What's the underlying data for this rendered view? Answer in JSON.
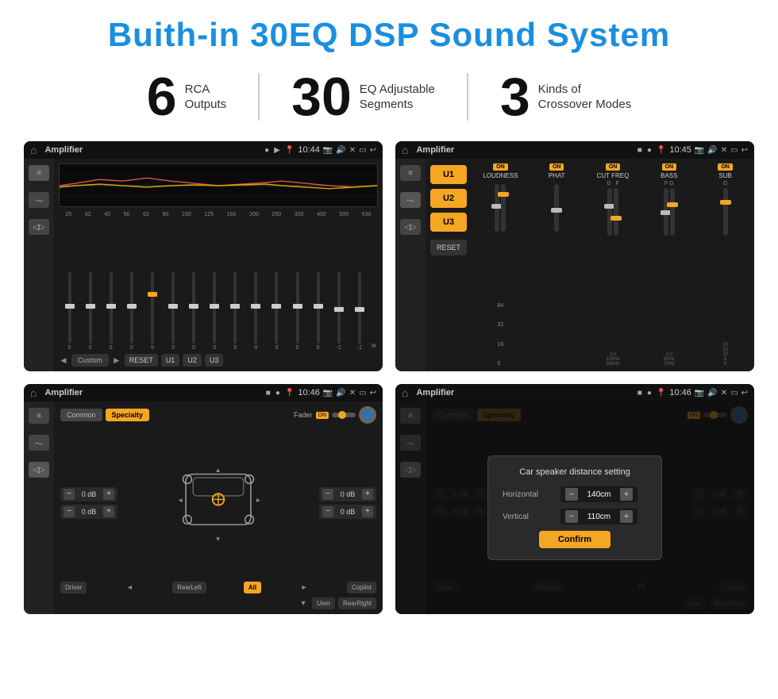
{
  "title": "Buith-in 30EQ DSP Sound System",
  "stats": [
    {
      "number": "6",
      "label": "RCA\nOutputs"
    },
    {
      "number": "30",
      "label": "EQ Adjustable\nSegments"
    },
    {
      "number": "3",
      "label": "Kinds of\nCrossover Modes"
    }
  ],
  "screens": [
    {
      "id": "screen1",
      "app_name": "Amplifier",
      "time": "10:44",
      "description": "EQ Sliders Screen"
    },
    {
      "id": "screen2",
      "app_name": "Amplifier",
      "time": "10:45",
      "description": "U1/U2/U3 Crossover Screen"
    },
    {
      "id": "screen3",
      "app_name": "Amplifier",
      "time": "10:46",
      "description": "Speaker Positioning Screen"
    },
    {
      "id": "screen4",
      "app_name": "Amplifier",
      "time": "10:46",
      "description": "Car Speaker Distance Dialog"
    }
  ],
  "eq_screen": {
    "frequencies": [
      "25",
      "32",
      "40",
      "50",
      "63",
      "80",
      "100",
      "125",
      "160",
      "200",
      "250",
      "320",
      "400",
      "500",
      "630"
    ],
    "values": [
      "0",
      "0",
      "0",
      "0",
      "5",
      "0",
      "0",
      "0",
      "0",
      "0",
      "0",
      "0",
      "0",
      "-1",
      "0",
      "-1"
    ],
    "preset": "Custom",
    "buttons": [
      "RESET",
      "U1",
      "U2",
      "U3"
    ]
  },
  "crossover_screen": {
    "units": [
      "U1",
      "U2",
      "U3"
    ],
    "controls": [
      {
        "name": "LOUDNESS",
        "on": true
      },
      {
        "name": "PHAT",
        "on": true
      },
      {
        "name": "CUT FREQ",
        "on": true
      },
      {
        "name": "BASS",
        "on": true
      },
      {
        "name": "SUB",
        "on": true
      }
    ],
    "reset_label": "RESET"
  },
  "speaker_screen": {
    "tabs": [
      "Common",
      "Specialty"
    ],
    "active_tab": "Specialty",
    "fader_label": "Fader",
    "fader_on": true,
    "db_values": [
      "0 dB",
      "0 dB",
      "0 dB",
      "0 dB"
    ],
    "position_buttons": [
      "Driver",
      "RearLeft",
      "All",
      "Copilot",
      "User",
      "RearRight"
    ],
    "all_active": true
  },
  "dialog_screen": {
    "title": "Car speaker distance setting",
    "horizontal_label": "Horizontal",
    "horizontal_value": "140cm",
    "vertical_label": "Vertical",
    "vertical_value": "110cm",
    "confirm_label": "Confirm"
  }
}
